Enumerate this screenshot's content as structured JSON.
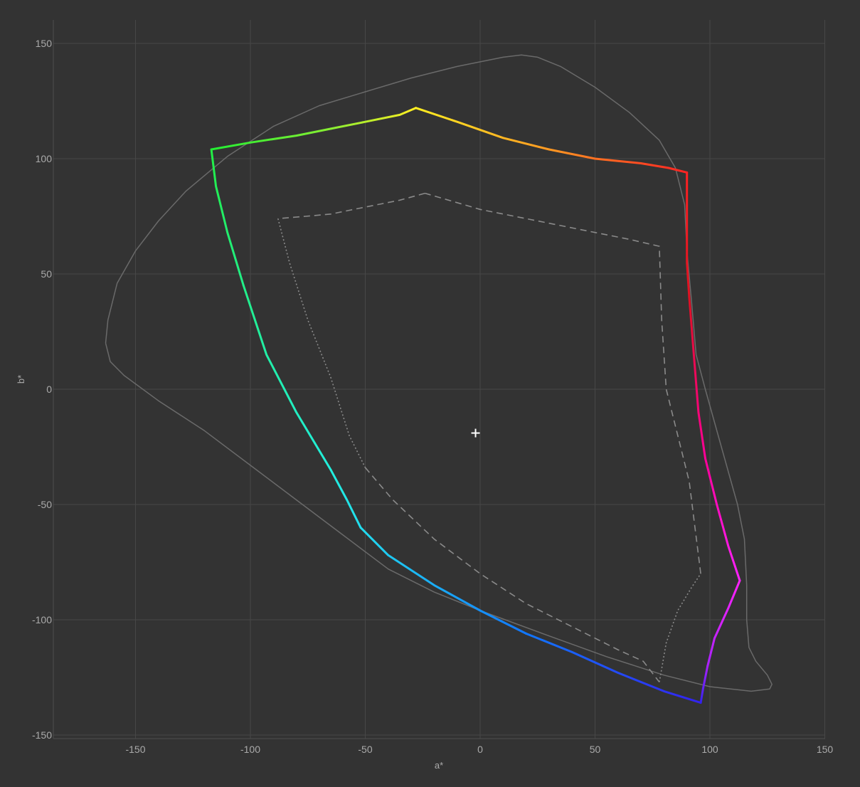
{
  "chart_data": {
    "type": "line",
    "title": "",
    "xlabel": "a*",
    "ylabel": "b*",
    "xlim": [
      -185,
      150
    ],
    "ylim": [
      -152,
      160
    ],
    "xticks": [
      -150,
      -100,
      -50,
      0,
      50,
      100,
      150
    ],
    "yticks": [
      150,
      100,
      50,
      0,
      -50,
      -100,
      -150
    ],
    "grid": true,
    "legend": "none",
    "colors": {
      "background": "#333333",
      "grid": "#474747",
      "axis": "#4d4d4d",
      "tick_text": "#aaaaaa",
      "reference_outline": "#6a6a6a",
      "inner_gamut": "#8a8a8a",
      "white_point": "#ffffff"
    },
    "white_point": {
      "a": -2,
      "b": -19
    },
    "series": [
      {
        "role": "reference-outline",
        "style": "solid",
        "points": [
          [
            -163,
            20
          ],
          [
            -162,
            30
          ],
          [
            -158,
            46
          ],
          [
            -150,
            60
          ],
          [
            -140,
            73
          ],
          [
            -128,
            86
          ],
          [
            -110,
            101
          ],
          [
            -90,
            114
          ],
          [
            -70,
            123
          ],
          [
            -50,
            129
          ],
          [
            -30,
            135
          ],
          [
            -10,
            140
          ],
          [
            10,
            144
          ],
          [
            18,
            145
          ],
          [
            25,
            144
          ],
          [
            35,
            140
          ],
          [
            50,
            131
          ],
          [
            65,
            120
          ],
          [
            78,
            108
          ],
          [
            85,
            96
          ],
          [
            89,
            80
          ],
          [
            90,
            60
          ],
          [
            92,
            38
          ],
          [
            94,
            15
          ],
          [
            98,
            0
          ],
          [
            105,
            -25
          ],
          [
            112,
            -50
          ],
          [
            115,
            -65
          ],
          [
            116,
            -85
          ],
          [
            116,
            -100
          ],
          [
            117,
            -112
          ],
          [
            120,
            -118
          ],
          [
            125,
            -124
          ],
          [
            127,
            -128
          ],
          [
            126,
            -130
          ],
          [
            118,
            -131
          ],
          [
            100,
            -129
          ],
          [
            80,
            -124
          ],
          [
            55,
            -116
          ],
          [
            30,
            -107
          ],
          [
            0,
            -96
          ],
          [
            -20,
            -88
          ],
          [
            -40,
            -78
          ],
          [
            -60,
            -63
          ],
          [
            -80,
            -48
          ],
          [
            -100,
            -33
          ],
          [
            -120,
            -18
          ],
          [
            -140,
            -5
          ],
          [
            -155,
            6
          ],
          [
            -161,
            12
          ],
          [
            -163,
            20
          ]
        ]
      },
      {
        "role": "inner-gamut",
        "style": "dashed",
        "points": [
          [
            -24,
            85
          ],
          [
            -35,
            82
          ],
          [
            -50,
            79
          ],
          [
            -65,
            76
          ],
          [
            -76,
            75
          ],
          [
            -88,
            74
          ]
        ]
      },
      {
        "role": "inner-gamut",
        "style": "dotted",
        "points": [
          [
            -88,
            74
          ],
          [
            -83,
            55
          ],
          [
            -75,
            30
          ],
          [
            -65,
            5
          ],
          [
            -57,
            -20
          ],
          [
            -50,
            -34
          ]
        ]
      },
      {
        "role": "inner-gamut",
        "style": "dashed",
        "points": [
          [
            -50,
            -34
          ],
          [
            -38,
            -48
          ],
          [
            -20,
            -65
          ],
          [
            0,
            -80
          ],
          [
            20,
            -93
          ],
          [
            40,
            -103
          ],
          [
            60,
            -113
          ],
          [
            71,
            -118
          ],
          [
            78,
            -127
          ]
        ]
      },
      {
        "role": "inner-gamut",
        "style": "dotted",
        "points": [
          [
            78,
            -127
          ],
          [
            81,
            -110
          ],
          [
            86,
            -96
          ],
          [
            92,
            -86
          ],
          [
            96,
            -80
          ]
        ]
      },
      {
        "role": "inner-gamut",
        "style": "dashed",
        "points": [
          [
            96,
            -80
          ],
          [
            91,
            -40
          ],
          [
            81,
            0
          ],
          [
            79,
            30
          ],
          [
            78,
            62
          ],
          [
            65,
            65
          ],
          [
            50,
            68
          ],
          [
            25,
            73
          ],
          [
            0,
            78
          ],
          [
            -24,
            85
          ]
        ]
      }
    ],
    "gamut": {
      "role": "main-gamut",
      "segments": [
        {
          "from": "#ffee22",
          "to": "#ff9922",
          "points": [
            [
              -28,
              122
            ],
            [
              -10,
              116
            ],
            [
              10,
              109
            ],
            [
              30,
              104
            ]
          ]
        },
        {
          "from": "#ff9922",
          "to": "#ff2222",
          "points": [
            [
              30,
              104
            ],
            [
              50,
              100
            ],
            [
              70,
              98
            ],
            [
              82,
              96
            ],
            [
              90,
              94
            ]
          ]
        },
        {
          "from": "#ff2222",
          "to": "#dd1122",
          "points": [
            [
              90,
              94
            ],
            [
              90,
              75
            ],
            [
              90,
              55
            ],
            [
              91,
              40
            ]
          ]
        },
        {
          "from": "#dd1122",
          "to": "#ff0099",
          "points": [
            [
              91,
              40
            ],
            [
              93,
              15
            ],
            [
              95,
              -10
            ],
            [
              98,
              -30
            ]
          ]
        },
        {
          "from": "#ff0099",
          "to": "#ff22ff",
          "points": [
            [
              98,
              -30
            ],
            [
              103,
              -50
            ],
            [
              108,
              -68
            ],
            [
              113,
              -83
            ]
          ]
        },
        {
          "from": "#ff22ff",
          "to": "#aa22ff",
          "points": [
            [
              113,
              -83
            ],
            [
              108,
              -95
            ],
            [
              102,
              -108
            ],
            [
              99,
              -120
            ]
          ]
        },
        {
          "from": "#aa22ff",
          "to": "#3322ee",
          "points": [
            [
              99,
              -120
            ],
            [
              97,
              -130
            ],
            [
              96,
              -136
            ]
          ]
        },
        {
          "from": "#3322ee",
          "to": "#1177ff",
          "points": [
            [
              96,
              -136
            ],
            [
              80,
              -131
            ],
            [
              60,
              -123
            ],
            [
              40,
              -114
            ],
            [
              20,
              -106
            ]
          ]
        },
        {
          "from": "#1177ff",
          "to": "#22ddee",
          "points": [
            [
              20,
              -106
            ],
            [
              0,
              -96
            ],
            [
              -20,
              -85
            ],
            [
              -40,
              -72
            ],
            [
              -52,
              -60
            ]
          ]
        },
        {
          "from": "#22ddee",
          "to": "#22eedd",
          "points": [
            [
              -52,
              -60
            ],
            [
              -58,
              -48
            ],
            [
              -65,
              -35
            ]
          ]
        },
        {
          "from": "#22eedd",
          "to": "#22ee88",
          "points": [
            [
              -65,
              -35
            ],
            [
              -80,
              -10
            ],
            [
              -93,
              15
            ],
            [
              -103,
              45
            ]
          ]
        },
        {
          "from": "#22ee88",
          "to": "#22ee44",
          "points": [
            [
              -103,
              45
            ],
            [
              -110,
              68
            ],
            [
              -115,
              88
            ],
            [
              -117,
              104
            ]
          ]
        },
        {
          "from": "#22ee33",
          "to": "#88ee33",
          "points": [
            [
              -117,
              104
            ],
            [
              -100,
              107
            ],
            [
              -80,
              110
            ],
            [
              -65,
              113
            ]
          ]
        },
        {
          "from": "#88ee33",
          "to": "#ffee22",
          "points": [
            [
              -65,
              113
            ],
            [
              -50,
              116
            ],
            [
              -35,
              119
            ],
            [
              -28,
              122
            ]
          ]
        }
      ]
    }
  }
}
